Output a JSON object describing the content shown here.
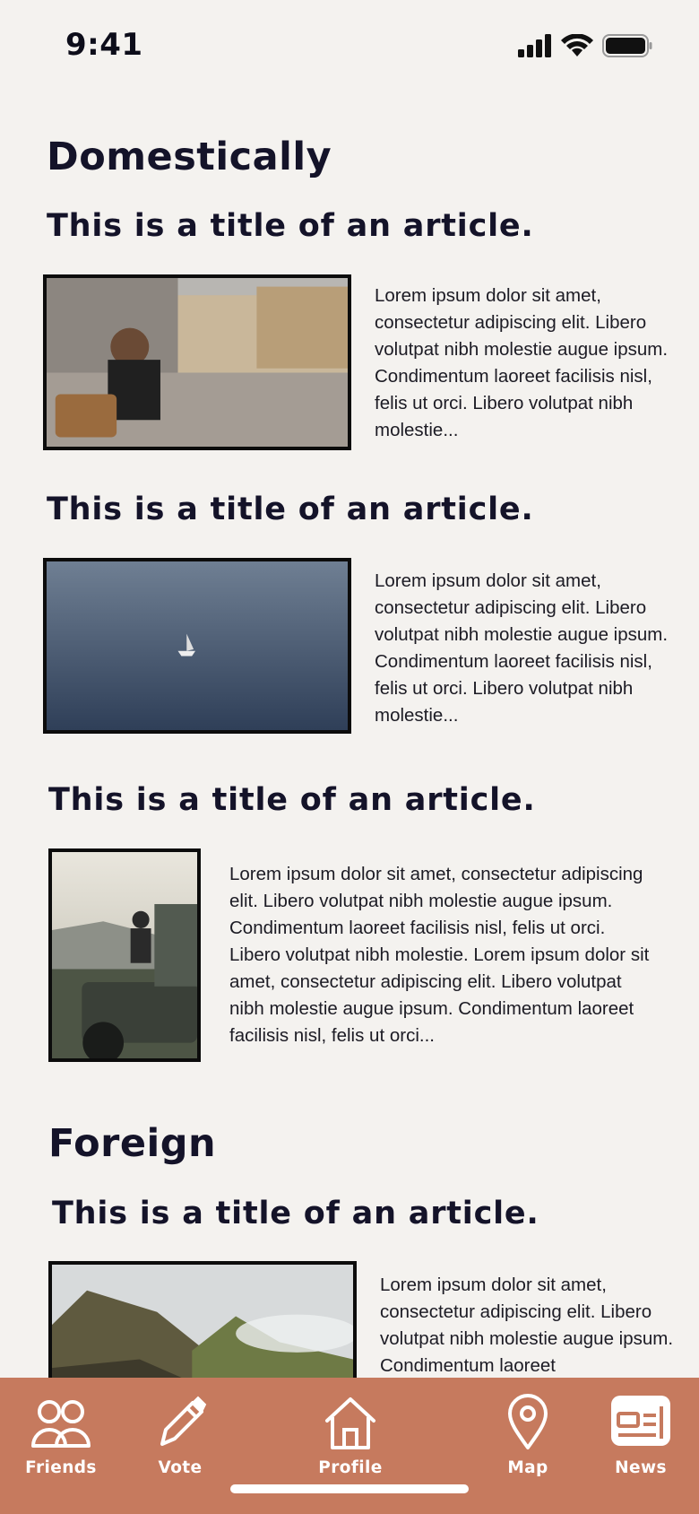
{
  "status_bar": {
    "time": "9:41"
  },
  "sections": [
    {
      "title": "Domestically",
      "articles": [
        {
          "title": "This is a title of an article.",
          "excerpt": "Lorem ipsum dolor sit amet, consectetur adipiscing elit. Libero volutpat nibh molestie augue ipsum. Condimentum laoreet facilisis nisl, felis ut orci. Libero volutpat nibh molestie..."
        },
        {
          "title": "This is a title of an article.",
          "excerpt": "Lorem ipsum dolor sit amet, consectetur adipiscing elit. Libero volutpat nibh molestie augue ipsum. Condimentum laoreet facilisis nisl, felis ut orci. Libero volutpat nibh molestie..."
        },
        {
          "title": "This is a title of an article.",
          "excerpt": "Lorem ipsum dolor sit amet, consectetur adipiscing elit. Libero volutpat nibh molestie augue ipsum. Condimentum laoreet facilisis nisl, felis ut orci. Libero volutpat nibh molestie. Lorem ipsum dolor sit amet, consectetur adipiscing elit. Libero volutpat nibh molestie augue ipsum. Condimentum laoreet facilisis nisl, felis ut orci..."
        }
      ]
    },
    {
      "title": "Foreign",
      "articles": [
        {
          "title": "This is a title of an article.",
          "excerpt": "Lorem ipsum dolor sit amet, consectetur adipiscing elit. Libero volutpat nibh molestie augue ipsum. Condimentum laoreet"
        }
      ]
    }
  ],
  "tab_bar": {
    "background": "#c67a5e",
    "active_tab": "News",
    "tabs": [
      {
        "label": "Friends",
        "icon": "friends-icon"
      },
      {
        "label": "Vote",
        "icon": "pencil-icon"
      },
      {
        "label": "Profile",
        "icon": "home-icon"
      },
      {
        "label": "Map",
        "icon": "map-pin-icon"
      },
      {
        "label": "News",
        "icon": "newspaper-icon"
      }
    ]
  }
}
